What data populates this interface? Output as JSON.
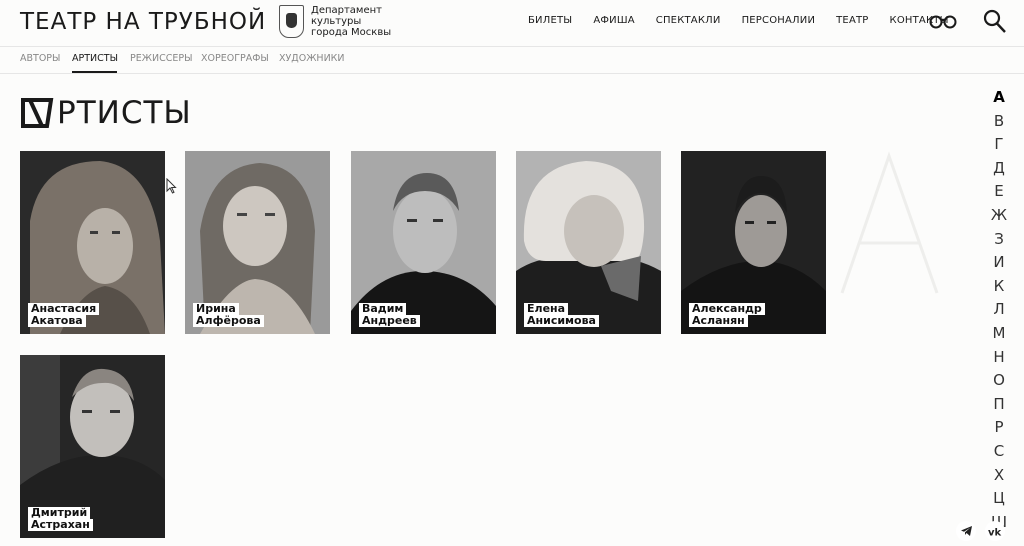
{
  "header": {
    "logo": "ТЕАТР НА ТРУБНОЙ",
    "dept": [
      "Департамент",
      "культуры",
      "города Москвы"
    ],
    "nav": [
      "БИЛЕТЫ",
      "АФИША",
      "СПЕКТАКЛИ",
      "ПЕРСОНАЛИИ",
      "ТЕАТР",
      "КОНТАКТЫ"
    ]
  },
  "subnav": {
    "tabs": [
      "АВТОРЫ",
      "АРТИСТЫ",
      "РЕЖИССЕРЫ",
      "ХОРЕОГРАФЫ",
      "ХУДОЖНИКИ"
    ],
    "active": "АРТИСТЫ"
  },
  "page": {
    "title": "РТИСТЫ",
    "watermark_letter": "А"
  },
  "artists": [
    {
      "first": "Анастасия",
      "last": "Акатова"
    },
    {
      "first": "Ирина",
      "last": "Алфёрова"
    },
    {
      "first": "Вадим",
      "last": "Андреев"
    },
    {
      "first": "Елена",
      "last": "Анисимова"
    },
    {
      "first": "Александр",
      "last": "Асланян"
    },
    {
      "first": "Дмитрий",
      "last": "Астрахан"
    }
  ],
  "alphabet": [
    "А",
    "В",
    "Г",
    "Д",
    "Е",
    "Ж",
    "З",
    "И",
    "К",
    "Л",
    "М",
    "Н",
    "О",
    "П",
    "Р",
    "С",
    "Х",
    "Ц",
    "Ш"
  ],
  "alphabet_active": "А",
  "social": [
    "telegram-icon",
    "vk-icon"
  ]
}
